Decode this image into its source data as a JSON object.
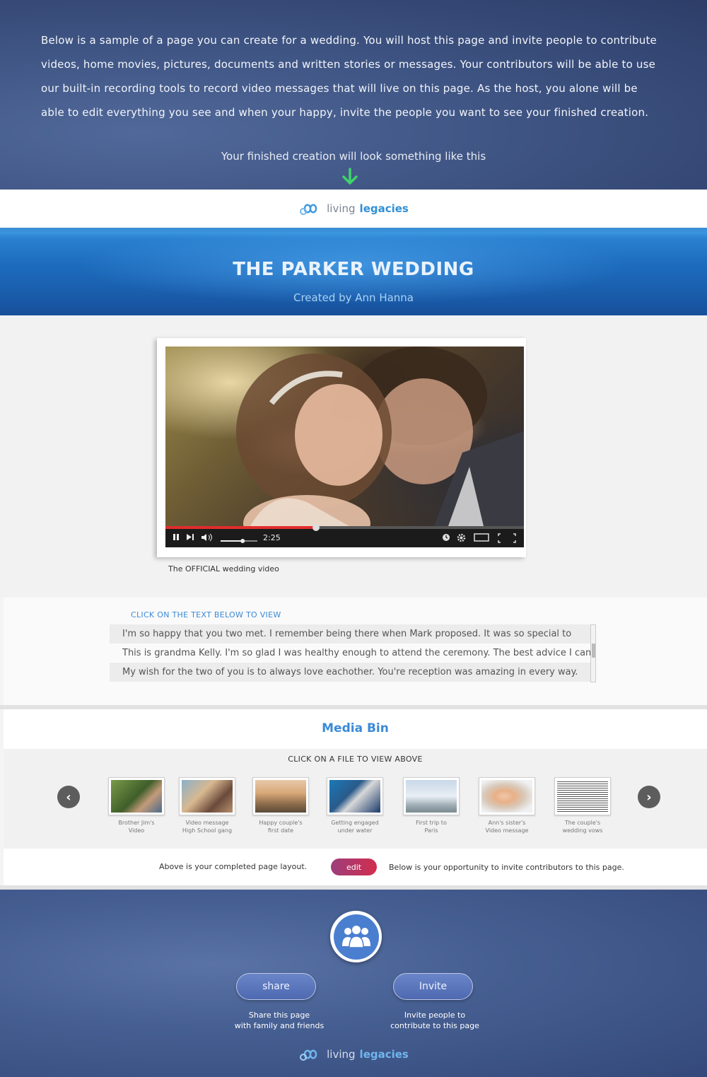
{
  "intro": {
    "paragraph": "Below is a sample  of a page you can create for  a wedding.  You will host this page and invite people to contribute videos, home movies, pictures, documents and written stories or messages.  Your contributors will be able to use our built-in recording tools to record video messages that will live on this page. As the host, you alone will be able to edit everything you see and  when your happy, invite the people you want to see your finished creation.",
    "subline": "Your finished creation will look something like this"
  },
  "logo": {
    "word1": "living",
    "word2": "legacies"
  },
  "banner": {
    "title": "THE PARKER WEDDING",
    "subtitle": "Created by Ann Hanna"
  },
  "video": {
    "time": "2:25",
    "progress": 0.42,
    "volume": 0.6,
    "caption": "The OFFICIAL wedding video"
  },
  "messages": {
    "heading": "CLICK ON THE TEXT BELOW TO VIEW",
    "items": [
      "I'm so happy that you two met. I remember being there when Mark proposed. It was so special to",
      "This is grandma Kelly. I'm so glad I was healthy enough to attend the ceremony. The best advice I can",
      "My wish for the two of you is to always love eachother. You're reception was amazing in every way."
    ]
  },
  "media_bin": {
    "title": "Media Bin",
    "hint": "CLICK ON A  FILE TO VIEW ABOVE",
    "prev_icon": "chevron-left-icon",
    "next_icon": "chevron-right-icon",
    "items": [
      {
        "line1": "Brother Jim's",
        "line2": "Video"
      },
      {
        "line1": "Video message",
        "line2": "High School gang"
      },
      {
        "line1": "Happy couple's",
        "line2": "first date"
      },
      {
        "line1": "Getting engaged",
        "line2": "under water"
      },
      {
        "line1": "First trip to",
        "line2": "Paris"
      },
      {
        "line1": "Ann's sister's",
        "line2": "Video message"
      },
      {
        "line1": "The couple's",
        "line2": "wedding vows"
      }
    ]
  },
  "edit_bar": {
    "left_text": "Above is your completed page layout.",
    "edit_label": "edit",
    "right_text": "Below is your opportunity to invite contributors to this page."
  },
  "footer": {
    "share_label": "share",
    "share_desc_1": "Share this page",
    "share_desc_2": "with family and friends",
    "invite_label": "Invite",
    "invite_desc_1": "Invite people to",
    "invite_desc_2": "contribute to this page"
  },
  "colors": {
    "accent_blue": "#3a8ad8",
    "edit_gradient_start": "#9b3d7a",
    "edit_gradient_end": "#d22e4e",
    "progress_red": "#e22c2c"
  }
}
